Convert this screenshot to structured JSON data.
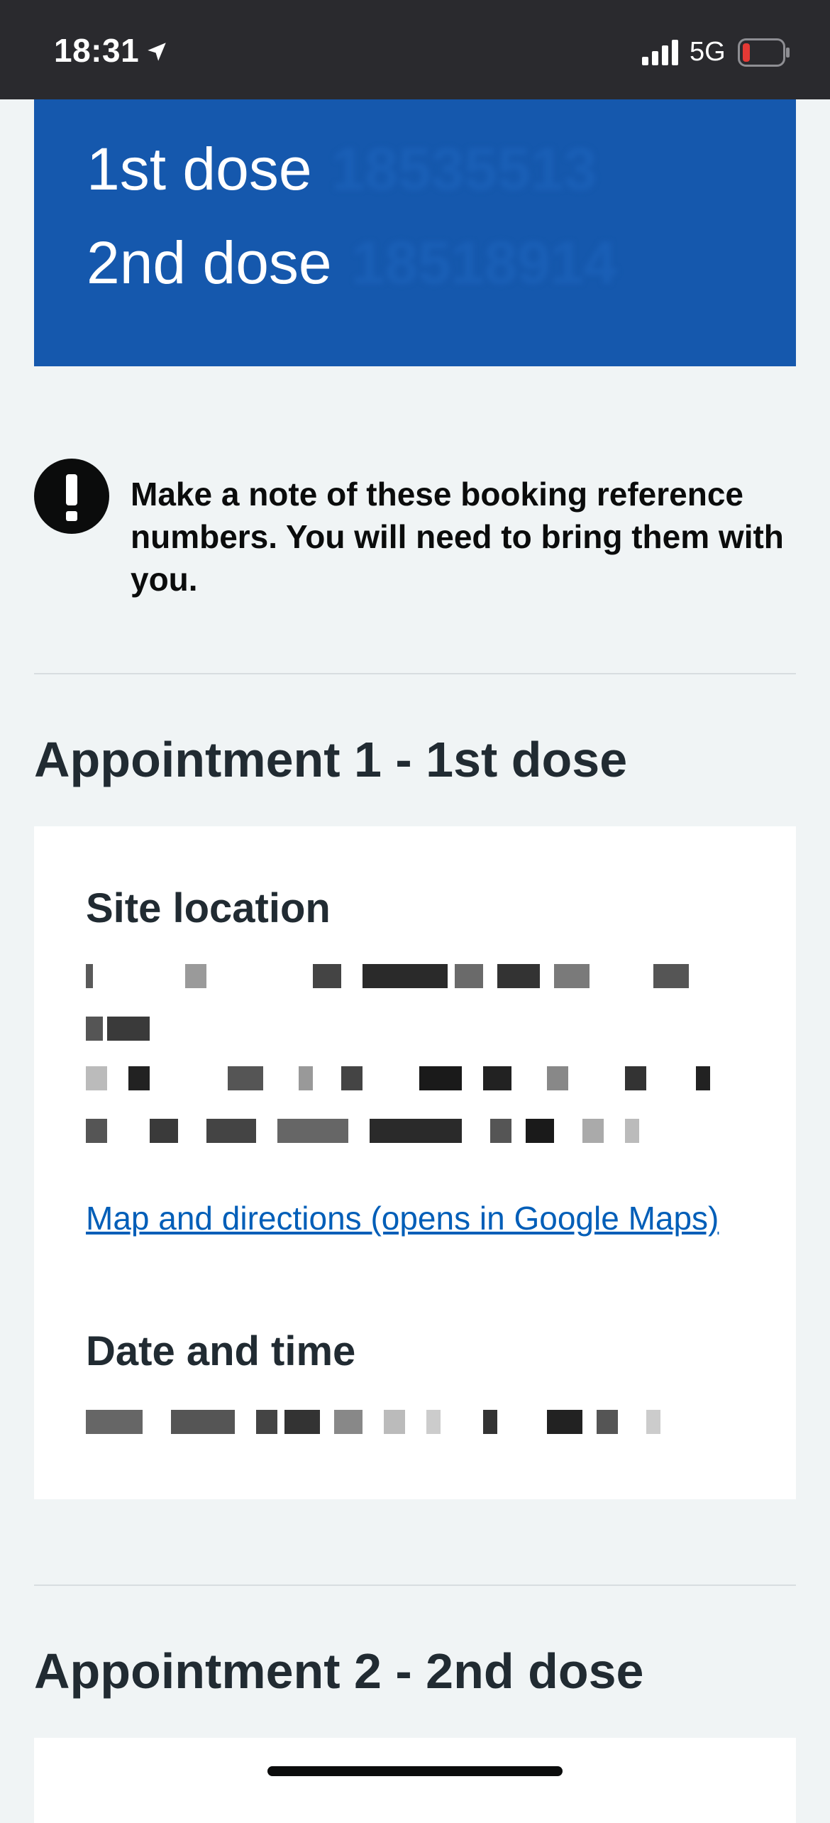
{
  "status_bar": {
    "time": "18:31",
    "network": "5G",
    "icons": [
      "location-arrow-icon",
      "cellular-signal-icon",
      "battery-low-icon"
    ],
    "battery_color": "#e53935"
  },
  "reference_panel": {
    "first_dose_label": "1st dose",
    "first_dose_ref": "18535513",
    "second_dose_label": "2nd dose",
    "second_dose_ref": "18518914",
    "background": "#1558ad"
  },
  "warning": {
    "icon": "exclamation-icon",
    "text": "Make a note of these booking reference numbers. You will need to bring them with you."
  },
  "appointment1": {
    "heading": "Appointment 1 - 1st dose",
    "site_location_label": "Site location",
    "map_link": "Map and directions (opens in Google Maps)",
    "date_time_label": "Date and time"
  },
  "appointment2": {
    "heading": "Appointment 2 - 2nd dose"
  },
  "colors": {
    "page_bg": "#f0f4f5",
    "link": "#005eb8",
    "text": "#212b32"
  }
}
